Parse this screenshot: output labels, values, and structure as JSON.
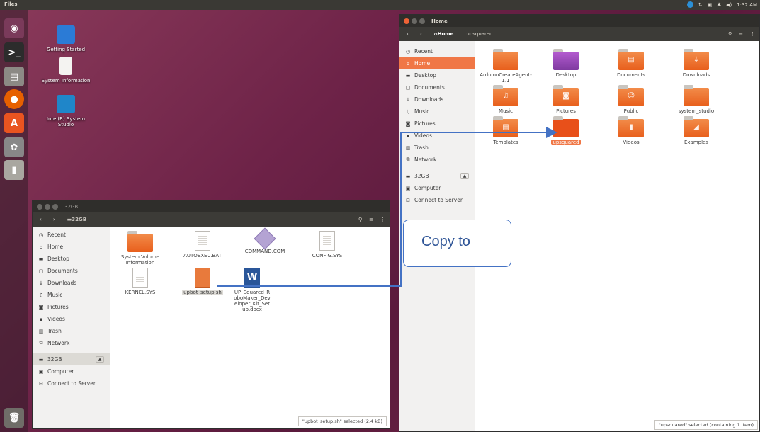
{
  "topbar": {
    "app_name": "Files",
    "time": "1:32 AM"
  },
  "launcher": {
    "items": [
      "dash-home",
      "terminal",
      "file-manager",
      "firefox",
      "software-center",
      "settings",
      "usb-drive",
      "trash"
    ]
  },
  "desktop": {
    "icons": [
      {
        "label": "Getting Started"
      },
      {
        "label": "System Information"
      },
      {
        "label": "Intel(R) System Studio"
      }
    ]
  },
  "home_window": {
    "title": "Home",
    "breadcrumb": {
      "current": "Home",
      "next": "upsquared"
    },
    "sidebar": [
      {
        "label": "Recent",
        "icon": "clock-icon"
      },
      {
        "label": "Home",
        "icon": "home-icon"
      },
      {
        "label": "Desktop",
        "icon": "folder-icon"
      },
      {
        "label": "Documents",
        "icon": "document-icon"
      },
      {
        "label": "Downloads",
        "icon": "download-icon"
      },
      {
        "label": "Music",
        "icon": "music-icon"
      },
      {
        "label": "Pictures",
        "icon": "camera-icon"
      },
      {
        "label": "Videos",
        "icon": "video-icon"
      },
      {
        "label": "Trash",
        "icon": "trash-icon"
      },
      {
        "label": "Network",
        "icon": "network-icon"
      },
      {
        "label": "32GB",
        "icon": "drive-icon"
      },
      {
        "label": "Computer",
        "icon": "computer-icon"
      },
      {
        "label": "Connect to Server",
        "icon": "server-icon"
      }
    ],
    "files": [
      {
        "label": "ArduinoCreateAgent-1.1",
        "kind": "folder"
      },
      {
        "label": "Desktop",
        "kind": "folder"
      },
      {
        "label": "Documents",
        "kind": "folder"
      },
      {
        "label": "Downloads",
        "kind": "folder"
      },
      {
        "label": "Music",
        "kind": "folder"
      },
      {
        "label": "Pictures",
        "kind": "folder"
      },
      {
        "label": "Public",
        "kind": "folder"
      },
      {
        "label": "system_studio",
        "kind": "folder"
      },
      {
        "label": "Templates",
        "kind": "folder"
      },
      {
        "label": "upsquared",
        "kind": "folder"
      },
      {
        "label": "Videos",
        "kind": "folder"
      },
      {
        "label": "Examples",
        "kind": "folder"
      }
    ],
    "status": "\"upsquared\" selected (containing 1 item)"
  },
  "drive_window": {
    "title": "32GB",
    "breadcrumb": "32GB",
    "sidebar": [
      {
        "label": "Recent",
        "icon": "clock-icon"
      },
      {
        "label": "Home",
        "icon": "home-icon"
      },
      {
        "label": "Desktop",
        "icon": "folder-icon"
      },
      {
        "label": "Documents",
        "icon": "document-icon"
      },
      {
        "label": "Downloads",
        "icon": "download-icon"
      },
      {
        "label": "Music",
        "icon": "music-icon"
      },
      {
        "label": "Pictures",
        "icon": "camera-icon"
      },
      {
        "label": "Videos",
        "icon": "video-icon"
      },
      {
        "label": "Trash",
        "icon": "trash-icon"
      },
      {
        "label": "Network",
        "icon": "network-icon"
      },
      {
        "label": "32GB",
        "icon": "drive-icon"
      },
      {
        "label": "Computer",
        "icon": "computer-icon"
      },
      {
        "label": "Connect to Server",
        "icon": "server-icon"
      }
    ],
    "files": [
      {
        "label": "System Volume Information",
        "kind": "folder"
      },
      {
        "label": "AUTOEXEC.BAT",
        "kind": "doc"
      },
      {
        "label": "COMMAND.COM",
        "kind": "gem"
      },
      {
        "label": "CONFIG.SYS",
        "kind": "doc"
      },
      {
        "label": "KERNEL.SYS",
        "kind": "doc"
      },
      {
        "label": "upbot_setup.sh",
        "kind": "sh"
      },
      {
        "label": "UP_Squared_RoboMaker_Developer_Kit_Setup.docx",
        "kind": "word"
      }
    ],
    "status": "\"upbot_setup.sh\" selected (2.4 kB)"
  },
  "annotation": {
    "text": "Copy to",
    "color": "#4472c4"
  },
  "colors": {
    "accent": "#f07746",
    "titlebar": "#2f2e2b",
    "arrow": "#4472c4"
  }
}
